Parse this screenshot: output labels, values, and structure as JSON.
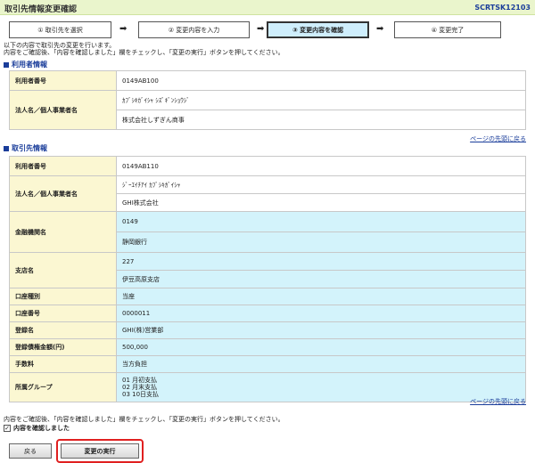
{
  "header": {
    "title": "取引先情報変更確認",
    "screen_code": "SCRTSK12103"
  },
  "steps": [
    {
      "label": "① 取引先を選択",
      "active": false
    },
    {
      "label": "② 変更内容を入力",
      "active": false
    },
    {
      "label": "③ 変更内容を確認",
      "active": true
    },
    {
      "label": "④ 変更完了",
      "active": false
    }
  ],
  "arrow": "➡",
  "intro": {
    "line1": "以下の内容で取引先の変更を行います。",
    "line2": "内容をご確認後、「内容を確認しました」欄をチェックし、「変更の実行」ボタンを押してください。"
  },
  "user_section": {
    "heading": "利用者情報",
    "user_no_label": "利用者番号",
    "user_no": "0149AB100",
    "name_label": "法人名／個人事業者名",
    "name_kana": "ｶﾌﾞｼｷｶﾞｲｼｬ ｼｽﾞｷﾞﾝｼｮｳｼﾞ",
    "name_kanji": "株式会社しずぎん商事"
  },
  "partner_section": {
    "heading": "取引先情報",
    "user_no_label": "利用者番号",
    "user_no": "0149AB110",
    "name_label": "法人名／個人事業者名",
    "name_kana": "ｼﾞｰｴｲﾁｱｲ ｶﾌﾞｼｷｶﾞｲｼｬ",
    "name_kanji": "GHI株式会社",
    "bank_label": "金融機関名",
    "bank_code": "0149",
    "bank_name": "静岡銀行",
    "branch_label": "支店名",
    "branch_code": "227",
    "branch_name": "伊豆高原支店",
    "acct_type_label": "口座種別",
    "acct_type": "当座",
    "acct_no_label": "口座番号",
    "acct_no": "0000011",
    "reg_name_label": "登録名",
    "reg_name": "GHI(株)営業部",
    "amount_label": "登録債権金額(円)",
    "amount": "500,000",
    "fee_label": "手数料",
    "fee": "当方負担",
    "group_label": "所属グループ",
    "groups": [
      "01 月初支払",
      "02 月末支払",
      "03 10日支払"
    ]
  },
  "links": {
    "back_to_top": "ページの先頭に戻る"
  },
  "bottom": {
    "note": "内容をご確認後、「内容を確認しました」欄をチェックし、「変更の実行」ボタンを押してください。",
    "confirm_label": "内容を確認しました",
    "confirm_checked": true
  },
  "buttons": {
    "back": "戻る",
    "execute": "変更の実行"
  }
}
